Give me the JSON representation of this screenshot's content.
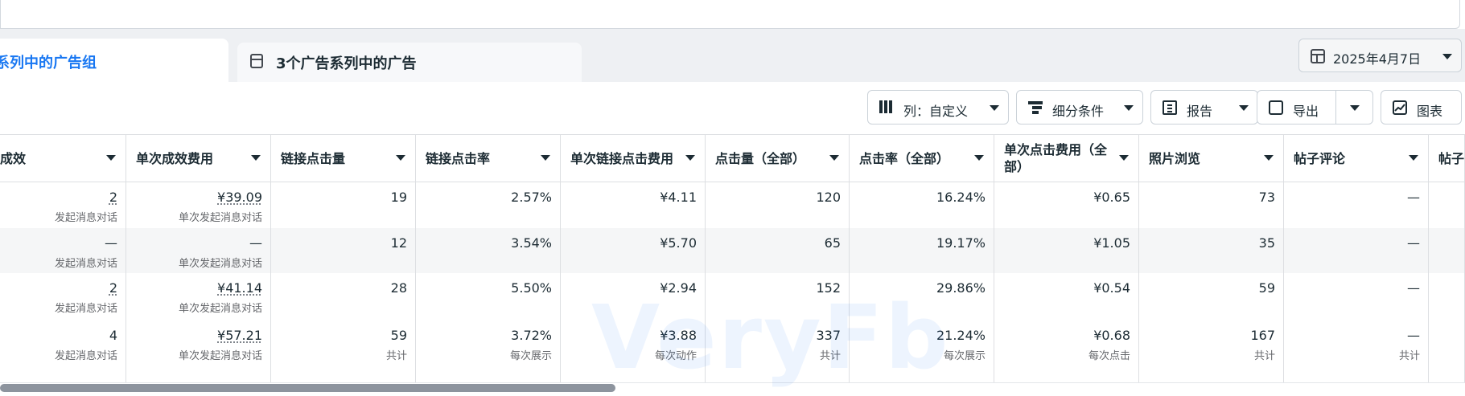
{
  "tabs": {
    "active_label": "系列中的广告组",
    "inactive_label": "3个广告系列中的广告"
  },
  "date_picker": {
    "label": "2025年4月7日"
  },
  "toolbar": {
    "columns_label": "列：自定义",
    "breakdown_label": "细分条件",
    "report_label": "报告",
    "export_label": "导出",
    "chart_label": "图表"
  },
  "watermark": "VeryFb",
  "table": {
    "headers": [
      "成效",
      "单次成效费用",
      "链接点击量",
      "链接点击率",
      "单次链接点击费用",
      "点击量（全部）",
      "点击率（全部）",
      "单次点击费用（全部）",
      "照片浏览",
      "帖子评论",
      "帖子"
    ],
    "rows": [
      [
        {
          "v": "2",
          "s": "发起消息对话",
          "link": true
        },
        {
          "v": "¥39.09",
          "s": "单次发起消息对话",
          "link": true
        },
        {
          "v": "19",
          "s": ""
        },
        {
          "v": "2.57%",
          "s": ""
        },
        {
          "v": "¥4.11",
          "s": ""
        },
        {
          "v": "120",
          "s": ""
        },
        {
          "v": "16.24%",
          "s": ""
        },
        {
          "v": "¥0.65",
          "s": ""
        },
        {
          "v": "73",
          "s": ""
        },
        {
          "v": "—",
          "s": ""
        },
        {
          "v": "",
          "s": ""
        }
      ],
      [
        {
          "v": "—",
          "s": "发起消息对话"
        },
        {
          "v": "—",
          "s": "单次发起消息对话"
        },
        {
          "v": "12",
          "s": ""
        },
        {
          "v": "3.54%",
          "s": ""
        },
        {
          "v": "¥5.70",
          "s": ""
        },
        {
          "v": "65",
          "s": ""
        },
        {
          "v": "19.17%",
          "s": ""
        },
        {
          "v": "¥1.05",
          "s": ""
        },
        {
          "v": "35",
          "s": ""
        },
        {
          "v": "—",
          "s": ""
        },
        {
          "v": "",
          "s": ""
        }
      ],
      [
        {
          "v": "2",
          "s": "发起消息对话",
          "link": true
        },
        {
          "v": "¥41.14",
          "s": "单次发起消息对话",
          "link": true
        },
        {
          "v": "28",
          "s": ""
        },
        {
          "v": "5.50%",
          "s": ""
        },
        {
          "v": "¥2.94",
          "s": ""
        },
        {
          "v": "152",
          "s": ""
        },
        {
          "v": "29.86%",
          "s": ""
        },
        {
          "v": "¥0.54",
          "s": ""
        },
        {
          "v": "59",
          "s": ""
        },
        {
          "v": "—",
          "s": ""
        },
        {
          "v": "",
          "s": ""
        }
      ],
      [
        {
          "v": "4",
          "s": "发起消息对话"
        },
        {
          "v": "¥57.21",
          "s": "单次发起消息对话",
          "link": true
        },
        {
          "v": "59",
          "s": "共计"
        },
        {
          "v": "3.72%",
          "s": "每次展示"
        },
        {
          "v": "¥3.88",
          "s": "每次动作"
        },
        {
          "v": "337",
          "s": "共计"
        },
        {
          "v": "21.24%",
          "s": "每次展示"
        },
        {
          "v": "¥0.68",
          "s": "每次点击"
        },
        {
          "v": "167",
          "s": "共计"
        },
        {
          "v": "—",
          "s": "共计"
        },
        {
          "v": "",
          "s": ""
        }
      ]
    ]
  }
}
